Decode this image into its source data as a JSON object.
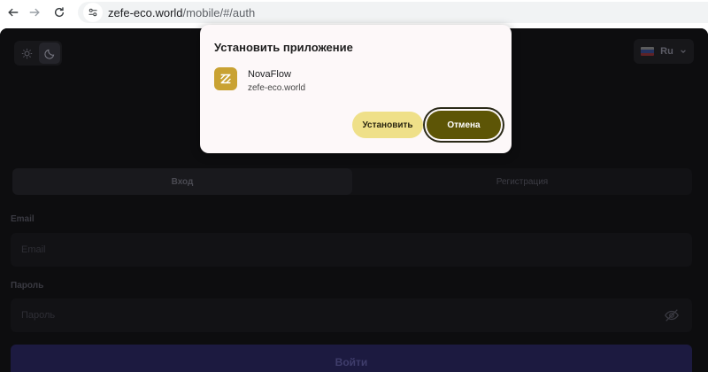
{
  "browser": {
    "url_host": "zefe-eco.world",
    "url_path": "/mobile/#/auth",
    "back_icon": "arrow-left-icon",
    "forward_icon": "arrow-right-icon",
    "reload_icon": "reload-icon",
    "site_info_icon": "tune-icon"
  },
  "install_dialog": {
    "title": "Установить приложение",
    "app_name": "NovaFlow",
    "app_domain": "zefe-eco.world",
    "install_label": "Установить",
    "cancel_label": "Отмена",
    "accent_color": "#5d5506",
    "install_color": "#efe089"
  },
  "header": {
    "language": "Ru",
    "theme_icons": [
      "sun-icon",
      "moon-icon"
    ]
  },
  "auth": {
    "tabs": [
      {
        "label": "Вход",
        "active": true
      },
      {
        "label": "Регистрация",
        "active": false
      }
    ],
    "email_label": "Email",
    "email_placeholder": "Email",
    "password_label": "Пароль",
    "password_placeholder": "Пароль",
    "submit_label": "Войти"
  }
}
